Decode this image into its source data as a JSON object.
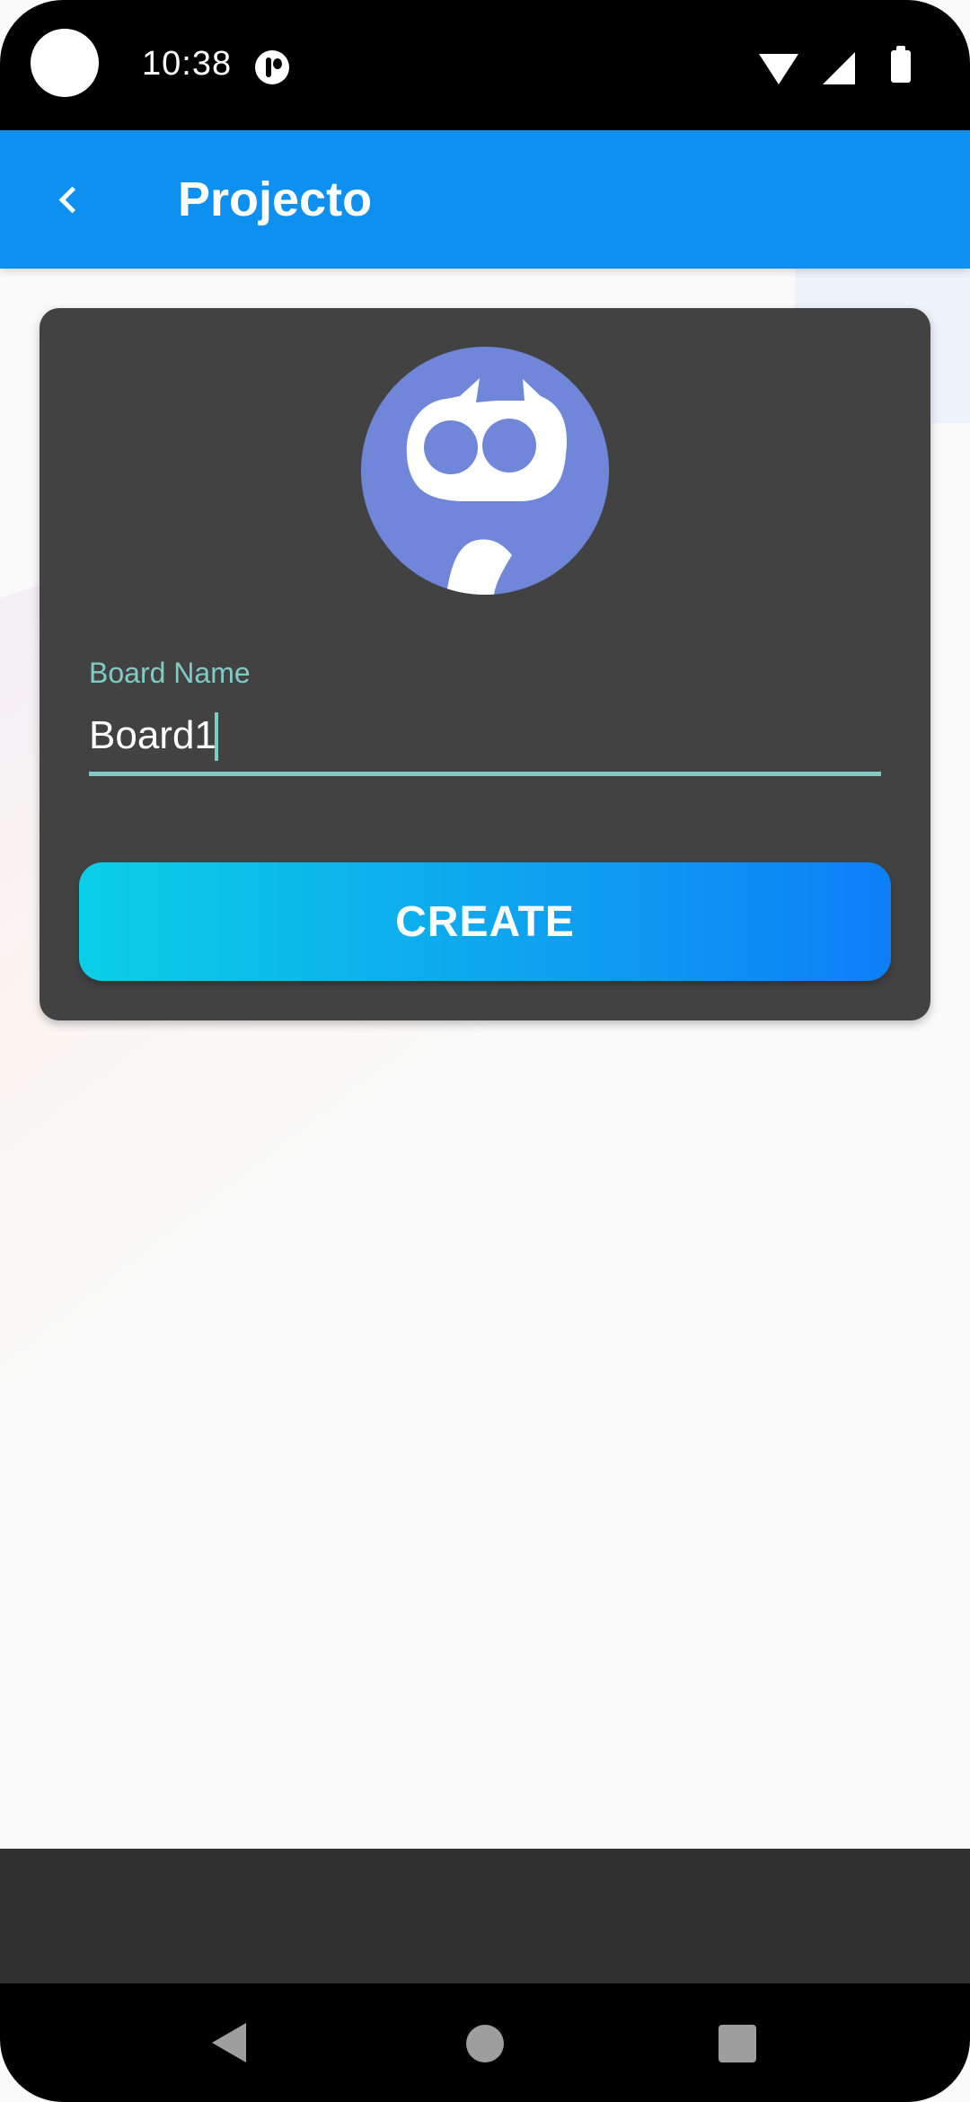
{
  "status_bar": {
    "time": "10:38"
  },
  "app_bar": {
    "title": "Projecto",
    "back_icon": "chevron-left-icon"
  },
  "form": {
    "avatar_icon": "robot-mascot-icon",
    "board_label": "Board Name",
    "board_value": "Board1",
    "create_label": "CREATE"
  },
  "colors": {
    "app_bar": "#0e90f0",
    "card": "#424242",
    "accent_teal": "#80cbc4",
    "button_gradient_start": "#0bcfe6",
    "button_gradient_end": "#0d7ff8",
    "avatar_bg": "#6f86d9"
  },
  "nav_bar": {
    "back": "back-triangle-icon",
    "home": "home-circle-icon",
    "recents": "recents-square-icon"
  }
}
